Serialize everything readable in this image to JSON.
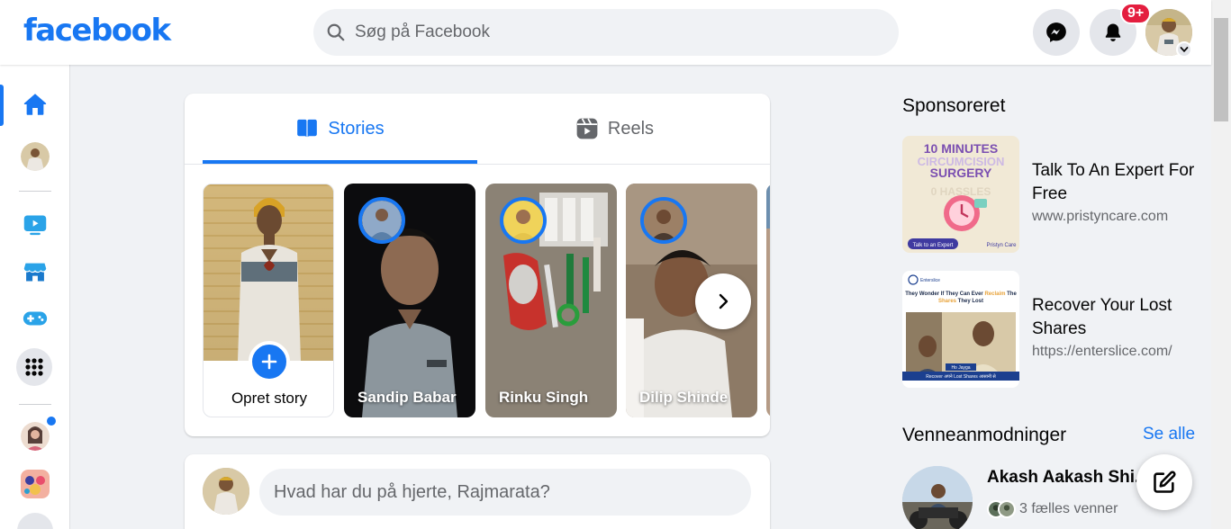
{
  "brand": {
    "logo_text": "facebook",
    "accent": "#1877f2"
  },
  "search": {
    "placeholder": "Søg på Facebook"
  },
  "header": {
    "messenger_icon": "messenger-icon",
    "notifications_icon": "bell-icon",
    "notification_count": "9+",
    "account_icon": "chevron-down-icon"
  },
  "leftrail": {
    "items": [
      {
        "name": "home",
        "icon": "home-icon",
        "active": true
      },
      {
        "name": "profile",
        "icon": "avatar"
      },
      {
        "name": "watch",
        "icon": "video-icon"
      },
      {
        "name": "marketplace",
        "icon": "store-icon"
      },
      {
        "name": "gaming",
        "icon": "gamepad-icon"
      },
      {
        "name": "menu",
        "icon": "grid-icon"
      },
      {
        "name": "group-1",
        "icon": "avatar"
      },
      {
        "name": "group-2",
        "icon": "avatar"
      }
    ]
  },
  "stories_card": {
    "tabs": [
      {
        "label": "Stories",
        "icon": "book-icon",
        "active": true
      },
      {
        "label": "Reels",
        "icon": "reels-icon",
        "active": false
      }
    ],
    "create_story_label": "Opret story",
    "stories": [
      {
        "name": "Sandip Babar"
      },
      {
        "name": "Rinku Singh"
      },
      {
        "name": "Dilip Shinde"
      }
    ]
  },
  "composer": {
    "placeholder": "Hvad har du på hjerte, Rajmarata?"
  },
  "sponsored": {
    "title": "Sponsoreret",
    "ads": [
      {
        "title": "Talk To An Expert For Free",
        "url": "www.pristyncare.com",
        "image_text": {
          "headline": "10 MINUTES",
          "line2": "CIRCUMCISION",
          "line3": "SURGERY",
          "line4": "0 HASSLES",
          "cta": "Talk to an Expert",
          "brand": "Pristyn Care"
        }
      },
      {
        "title": "Recover Your Lost Shares",
        "url": "https://enterslice.com/",
        "image_text": {
          "brand": "Enterslice",
          "headline_a": "They Wonder If They Can Ever ",
          "headline_b": "Reclaim",
          "headline_c": " The ",
          "headline_d": "Shares",
          "headline_e": " They Lost",
          "subtitle": "Ho Jayga",
          "footer": "Recover अपने Lost Shares आसानी से"
        }
      }
    ]
  },
  "friend_requests": {
    "title": "Venneanmodninger",
    "see_all": "Se alle",
    "items": [
      {
        "name": "Akash Aakash Shi...",
        "mutual": "3 fælles venner"
      }
    ]
  }
}
